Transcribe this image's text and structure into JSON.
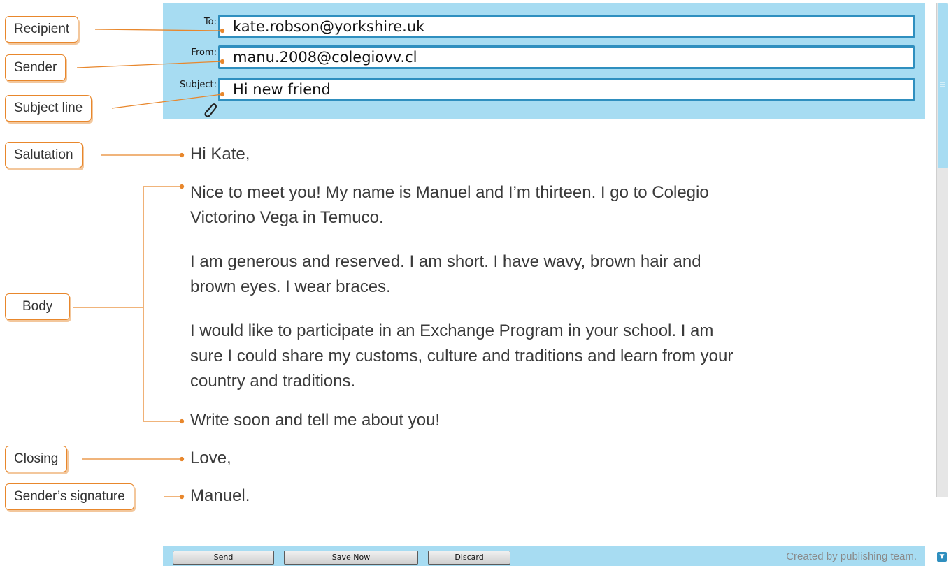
{
  "email": {
    "fields": [
      {
        "label": "To:",
        "value": "kate.robson@yorkshire.uk"
      },
      {
        "label": "From:",
        "value": "manu.2008@colegiovv.cl"
      },
      {
        "label": "Subject:",
        "value": "Hi new friend"
      }
    ],
    "body": {
      "salutation": "Hi Kate,",
      "paragraphs": [
        [
          "Nice to meet you! My name is Manuel and I’m thirteen. I go to Colegio",
          "Victorino Vega in Temuco."
        ],
        [
          "I am generous and reserved. I am short. I have wavy, brown hair and",
          "brown eyes. I wear braces."
        ],
        [
          "I would like to participate in an Exchange Program in your school. I am",
          "sure I could share my customs, culture and traditions and learn from your",
          "country and traditions."
        ]
      ],
      "closing_sentence": "Write soon and tell me about you!",
      "closing": "Love,",
      "signature": "Manuel."
    },
    "buttons": {
      "send": "Send",
      "save": "Save Now",
      "discard": "Discard"
    },
    "footer_note": "Created by publishing team."
  },
  "callouts": {
    "recipient": "Recipient",
    "sender": "Sender",
    "subject": "Subject line",
    "salutation": "Salutation",
    "body": "Body",
    "closing": "Closing",
    "signature": "Sender’s signature"
  },
  "colors": {
    "accent": "#e8872c",
    "panel": "#a7dcf2",
    "field_border": "#2f8fbf"
  }
}
